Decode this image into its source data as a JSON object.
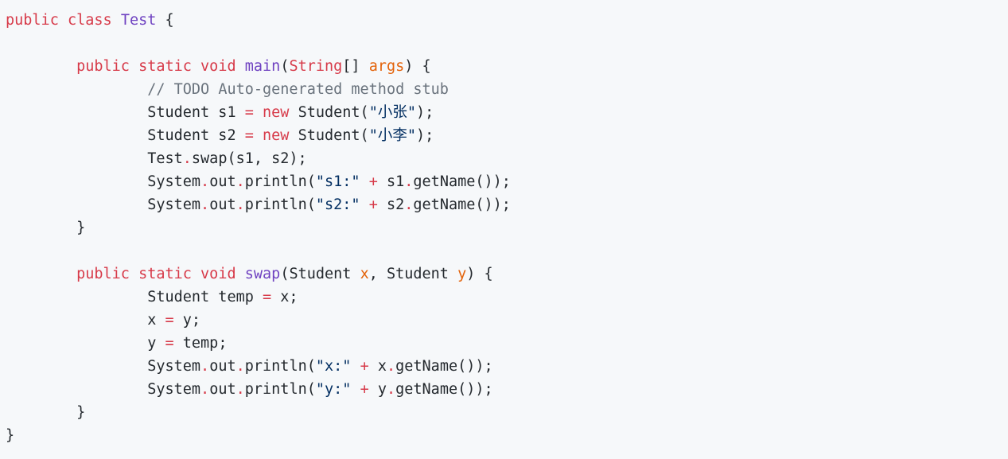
{
  "colors": {
    "background": "#f6f8fa",
    "keyword": "#d73a49",
    "function": "#6f42c1",
    "parameter": "#e36209",
    "comment": "#6a737d",
    "string": "#032f62",
    "text": "#24292e"
  },
  "code": {
    "language": "java",
    "lines": [
      [
        {
          "t": "kw",
          "v": "public"
        },
        {
          "t": "plain",
          "v": " "
        },
        {
          "t": "kw",
          "v": "class"
        },
        {
          "t": "plain",
          "v": " "
        },
        {
          "t": "fn",
          "v": "Test"
        },
        {
          "t": "plain",
          "v": " {"
        }
      ],
      [],
      [
        {
          "t": "plain",
          "v": "        "
        },
        {
          "t": "kw",
          "v": "public"
        },
        {
          "t": "plain",
          "v": " "
        },
        {
          "t": "kw",
          "v": "static"
        },
        {
          "t": "plain",
          "v": " "
        },
        {
          "t": "kw",
          "v": "void"
        },
        {
          "t": "plain",
          "v": " "
        },
        {
          "t": "fn",
          "v": "main"
        },
        {
          "t": "plain",
          "v": "("
        },
        {
          "t": "kw",
          "v": "String"
        },
        {
          "t": "plain",
          "v": "[] "
        },
        {
          "t": "param",
          "v": "args"
        },
        {
          "t": "plain",
          "v": ") {"
        }
      ],
      [
        {
          "t": "plain",
          "v": "                "
        },
        {
          "t": "cm",
          "v": "// TODO Auto-generated method stub"
        }
      ],
      [
        {
          "t": "plain",
          "v": "                Student s1 "
        },
        {
          "t": "op",
          "v": "="
        },
        {
          "t": "plain",
          "v": " "
        },
        {
          "t": "kw",
          "v": "new"
        },
        {
          "t": "plain",
          "v": " Student("
        },
        {
          "t": "str",
          "v": "\"小张\""
        },
        {
          "t": "plain",
          "v": ");"
        }
      ],
      [
        {
          "t": "plain",
          "v": "                Student s2 "
        },
        {
          "t": "op",
          "v": "="
        },
        {
          "t": "plain",
          "v": " "
        },
        {
          "t": "kw",
          "v": "new"
        },
        {
          "t": "plain",
          "v": " Student("
        },
        {
          "t": "str",
          "v": "\"小李\""
        },
        {
          "t": "plain",
          "v": ");"
        }
      ],
      [
        {
          "t": "plain",
          "v": "                Test"
        },
        {
          "t": "op",
          "v": "."
        },
        {
          "t": "plain",
          "v": "swap(s1, s2);"
        }
      ],
      [
        {
          "t": "plain",
          "v": "                System"
        },
        {
          "t": "op",
          "v": "."
        },
        {
          "t": "plain",
          "v": "out"
        },
        {
          "t": "op",
          "v": "."
        },
        {
          "t": "plain",
          "v": "println("
        },
        {
          "t": "str",
          "v": "\"s1:\""
        },
        {
          "t": "plain",
          "v": " "
        },
        {
          "t": "op",
          "v": "+"
        },
        {
          "t": "plain",
          "v": " s1"
        },
        {
          "t": "op",
          "v": "."
        },
        {
          "t": "plain",
          "v": "getName());"
        }
      ],
      [
        {
          "t": "plain",
          "v": "                System"
        },
        {
          "t": "op",
          "v": "."
        },
        {
          "t": "plain",
          "v": "out"
        },
        {
          "t": "op",
          "v": "."
        },
        {
          "t": "plain",
          "v": "println("
        },
        {
          "t": "str",
          "v": "\"s2:\""
        },
        {
          "t": "plain",
          "v": " "
        },
        {
          "t": "op",
          "v": "+"
        },
        {
          "t": "plain",
          "v": " s2"
        },
        {
          "t": "op",
          "v": "."
        },
        {
          "t": "plain",
          "v": "getName());"
        }
      ],
      [
        {
          "t": "plain",
          "v": "        }"
        }
      ],
      [],
      [
        {
          "t": "plain",
          "v": "        "
        },
        {
          "t": "kw",
          "v": "public"
        },
        {
          "t": "plain",
          "v": " "
        },
        {
          "t": "kw",
          "v": "static"
        },
        {
          "t": "plain",
          "v": " "
        },
        {
          "t": "kw",
          "v": "void"
        },
        {
          "t": "plain",
          "v": " "
        },
        {
          "t": "fn",
          "v": "swap"
        },
        {
          "t": "plain",
          "v": "(Student "
        },
        {
          "t": "param",
          "v": "x"
        },
        {
          "t": "plain",
          "v": ", Student "
        },
        {
          "t": "param",
          "v": "y"
        },
        {
          "t": "plain",
          "v": ") {"
        }
      ],
      [
        {
          "t": "plain",
          "v": "                Student temp "
        },
        {
          "t": "op",
          "v": "="
        },
        {
          "t": "plain",
          "v": " x;"
        }
      ],
      [
        {
          "t": "plain",
          "v": "                x "
        },
        {
          "t": "op",
          "v": "="
        },
        {
          "t": "plain",
          "v": " y;"
        }
      ],
      [
        {
          "t": "plain",
          "v": "                y "
        },
        {
          "t": "op",
          "v": "="
        },
        {
          "t": "plain",
          "v": " temp;"
        }
      ],
      [
        {
          "t": "plain",
          "v": "                System"
        },
        {
          "t": "op",
          "v": "."
        },
        {
          "t": "plain",
          "v": "out"
        },
        {
          "t": "op",
          "v": "."
        },
        {
          "t": "plain",
          "v": "println("
        },
        {
          "t": "str",
          "v": "\"x:\""
        },
        {
          "t": "plain",
          "v": " "
        },
        {
          "t": "op",
          "v": "+"
        },
        {
          "t": "plain",
          "v": " x"
        },
        {
          "t": "op",
          "v": "."
        },
        {
          "t": "plain",
          "v": "getName());"
        }
      ],
      [
        {
          "t": "plain",
          "v": "                System"
        },
        {
          "t": "op",
          "v": "."
        },
        {
          "t": "plain",
          "v": "out"
        },
        {
          "t": "op",
          "v": "."
        },
        {
          "t": "plain",
          "v": "println("
        },
        {
          "t": "str",
          "v": "\"y:\""
        },
        {
          "t": "plain",
          "v": " "
        },
        {
          "t": "op",
          "v": "+"
        },
        {
          "t": "plain",
          "v": " y"
        },
        {
          "t": "op",
          "v": "."
        },
        {
          "t": "plain",
          "v": "getName());"
        }
      ],
      [
        {
          "t": "plain",
          "v": "        }"
        }
      ],
      [
        {
          "t": "plain",
          "v": "}"
        }
      ]
    ]
  }
}
